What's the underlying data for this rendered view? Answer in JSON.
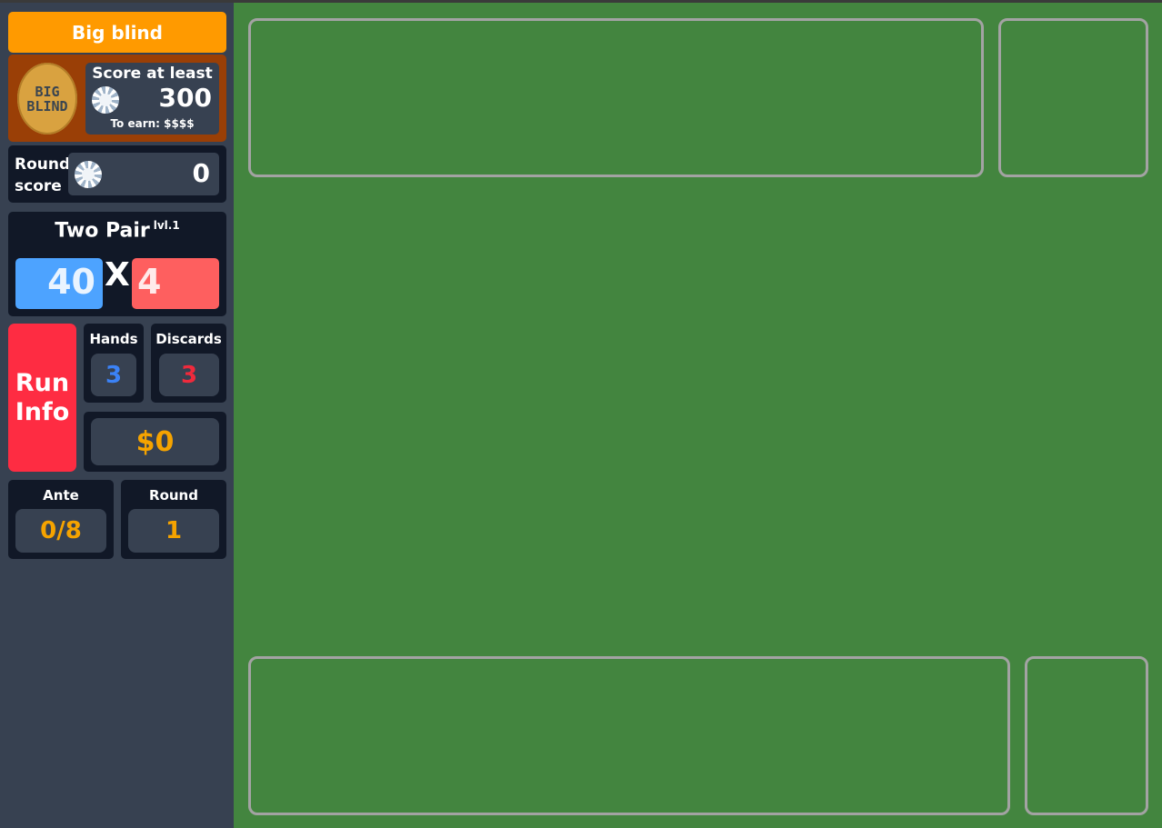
{
  "blind": {
    "title": "Big blind",
    "chip_text": "BIG\nBLIND",
    "score_label": "Score at least",
    "score_target": "300",
    "earn_label": "To earn: $$$$"
  },
  "round_score": {
    "label": "Round score",
    "value": "0"
  },
  "hand": {
    "name": "Two Pair",
    "level": "lvl.1",
    "chips": "40",
    "times": "X",
    "mult": "4"
  },
  "run_info": {
    "label": "Run Info"
  },
  "hands": {
    "label": "Hands",
    "value": "3"
  },
  "discards": {
    "label": "Discards",
    "value": "3"
  },
  "money": {
    "value": "$0"
  },
  "ante": {
    "label": "Ante",
    "value": "0/8"
  },
  "round": {
    "label": "Round",
    "value": "1"
  },
  "colors": {
    "blind_title": "#ff9a00",
    "blind_panel": "#9a3f06",
    "chips": "#4da3ff",
    "mult": "#fe5f5f",
    "run_info": "#fe2c42",
    "hands_value": "#3b82f6",
    "discards_value": "#ef2a3c",
    "money_value": "#f5a300",
    "table": "#43853f",
    "sidebar": "#374151"
  }
}
